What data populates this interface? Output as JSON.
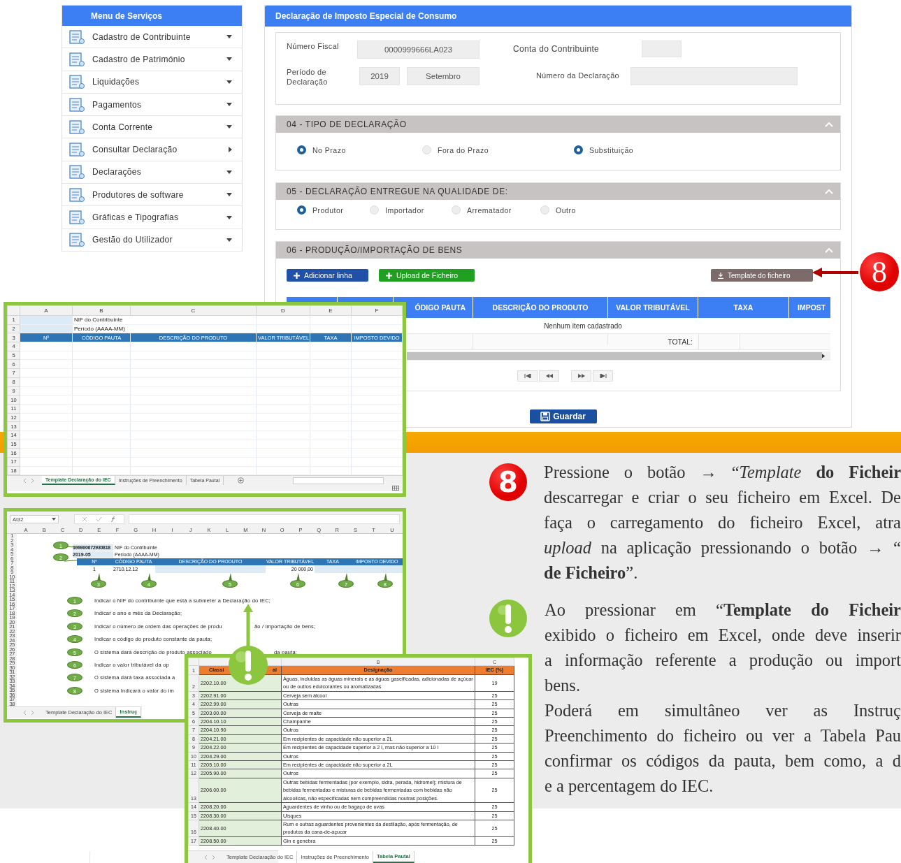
{
  "menu": {
    "title": "Menu de Serviços",
    "items": [
      {
        "label": "Cadastro de Contribuinte",
        "kind": "down"
      },
      {
        "label": "Cadastro de Património",
        "kind": "down"
      },
      {
        "label": "Liquidações",
        "kind": "down"
      },
      {
        "label": "Pagamentos",
        "kind": "down"
      },
      {
        "label": "Conta Corrente",
        "kind": "down"
      },
      {
        "label": "Consultar Declaração",
        "kind": "right"
      },
      {
        "label": "Declarações",
        "kind": "down"
      },
      {
        "label": "Produtores de software",
        "kind": "down"
      },
      {
        "label": "Gráficas e Tipografias",
        "kind": "down"
      },
      {
        "label": "Gestão do Utilizador",
        "kind": "down"
      }
    ]
  },
  "form": {
    "title": "Declaração de Imposto Especial de Consumo",
    "numero_fiscal": {
      "label": "Número Fiscal",
      "value": "0000999666LA023"
    },
    "conta": {
      "label": "Conta do Contribuinte"
    },
    "periodo": {
      "label": "Período de Declaração",
      "year": "2019",
      "month": "Setembro"
    },
    "numero_declaracao": {
      "label": "Número da Declaração"
    },
    "sections": [
      {
        "title": "04 - TIPO DE DECLARAÇÃO",
        "options": [
          {
            "label": "No Prazo",
            "selected": true
          },
          {
            "label": "Fora do Prazo",
            "selected": false
          },
          {
            "label": "Substituição",
            "selected": true
          }
        ]
      },
      {
        "title": "05 - DECLARAÇÃO ENTREGUE NA QUALIDADE DE:",
        "options": [
          {
            "label": "Produtor",
            "selected": true
          },
          {
            "label": "Importador",
            "selected": false
          },
          {
            "label": "Arrematador",
            "selected": false
          },
          {
            "label": "Outro",
            "selected": false
          }
        ]
      },
      {
        "title": "06 - PRODUÇÃO/IMPORTAÇÃO DE BENS"
      }
    ],
    "buttons": [
      {
        "label": "Adicionar linha",
        "kind": "add"
      },
      {
        "label": "Upload de Ficheiro",
        "kind": "upload"
      },
      {
        "label": "Template do ficheiro",
        "kind": "template"
      }
    ],
    "table": {
      "columns": [
        "ÓDIGO PAUTA",
        "DESCRIÇÃO DO PRODUTO",
        "VALOR TRIBUTÁVEL",
        "TAXA",
        "IMPOST"
      ],
      "empty": "Nenhum item cadastrado",
      "total_label": "TOTAL:"
    },
    "save_button": "Guardar"
  },
  "callout": {
    "number": "8"
  },
  "template_sheet": {
    "columns": [
      "A",
      "B",
      "C",
      "D",
      "E",
      "F"
    ],
    "rows": [
      "1",
      "2",
      "3",
      "4",
      "5",
      "6",
      "7",
      "8",
      "9",
      "10",
      "11",
      "12",
      "13",
      "14",
      "15",
      "16",
      "17",
      "18"
    ],
    "labels": [
      "NIF do Contribuinte",
      "Período (AAAA-MM)"
    ],
    "header": [
      "Nº",
      "CÓDIGO PAUTA",
      "DESCRIÇÃO DO PRODUTO",
      "VALOR TRIBUTÁVEL",
      "TAXA",
      "IMPOSTO DEVIDO"
    ],
    "tabs": [
      {
        "label": "Template Declaração do IEC",
        "selected": true
      },
      {
        "label": "Instruções de Preenchimento",
        "selected": false
      },
      {
        "label": "Tabela Pautal",
        "selected": false
      }
    ]
  },
  "instructions_sheet": {
    "name_box": "AI32",
    "columns": [
      "A",
      "B",
      "C",
      "D",
      "E",
      "F",
      "G",
      "H",
      "I",
      "J",
      "K",
      "L",
      "M",
      "N",
      "O",
      "P",
      "Q",
      "R",
      "S",
      "T",
      "U"
    ],
    "rows": [
      "1",
      "2",
      "3",
      "4",
      "5",
      "6",
      "7",
      "8",
      "9",
      "10",
      "11",
      "12",
      "13",
      "14",
      "15",
      "16",
      "17",
      "18",
      "19",
      "20",
      "21",
      "22",
      "23",
      "24",
      "25",
      "26",
      "27",
      "28",
      "29",
      "30",
      "31",
      "32",
      "33",
      "34",
      "35",
      "36",
      "37",
      "38"
    ],
    "nif_value": "100000672930818",
    "nif_label": "NIF do Contribuinte",
    "period_value": "2019-05",
    "period_label": "Período (AAAA-MM)",
    "header": [
      "Nº",
      "CÓDIGO PAUTA",
      "DESCRIÇÃO DO PRODUTO",
      "VALOR TRIBUTÁVEL",
      "TAXA",
      "IMPOSTO DEVIDO"
    ],
    "row": {
      "number": "1",
      "code": "2710.12.12",
      "value": "20 000,00"
    },
    "top_callouts": [
      "1",
      "2"
    ],
    "column_callouts": [
      "3",
      "4",
      "5",
      "6",
      "7",
      "8"
    ],
    "instructions": [
      {
        "number": "1",
        "text": "Indicar o NIF do contribuinte que está a submeter a Declaração do IEC;"
      },
      {
        "number": "2",
        "text": "Indicar o ano e mês da Declaração;"
      },
      {
        "number": "3",
        "text": "Indicar o número de ordem das operações de produ",
        "tail": "ão / importação de bens;"
      },
      {
        "number": "4",
        "text": "Indicar o código do produto constante da pauta;"
      },
      {
        "number": "5",
        "text": "O sistema dará descrição do produto associado",
        "tail": "da pauta;"
      },
      {
        "number": "6",
        "text": "Indicar o valor tributável da op"
      },
      {
        "number": "7",
        "text": "O sistema dará taxa associada a"
      },
      {
        "number": "8",
        "text": "O sistema Indicará o valor do im"
      }
    ],
    "tabs": [
      {
        "label": "Template Declaração do IEC",
        "selected": false
      },
      {
        "label": "Instruç",
        "selected": true
      }
    ]
  },
  "tariff_sheet": {
    "columns": [
      "B",
      "C"
    ],
    "header": {
      "code_parts": [
        "Classi",
        "al"
      ],
      "designation": "Designação",
      "rate": "IEC (%)"
    },
    "rows": [
      {
        "n": "2",
        "code": "2202.10.00",
        "designation": "Águas, incluidas as águas minerais e as águas gaseificadas, adicionadas de açúcar ou de outros edulcorantes ou aromatizadas",
        "rate": "19"
      },
      {
        "n": "3",
        "code": "2202.91.00",
        "designation": "Cerveja sem álcool",
        "rate": "25"
      },
      {
        "n": "4",
        "code": "2202.99.00",
        "designation": "Outras",
        "rate": "25"
      },
      {
        "n": "5",
        "code": "2203.00.00",
        "designation": "Cerveja de malte",
        "rate": "25"
      },
      {
        "n": "6",
        "code": "2204.10.10",
        "designation": "Champanhe",
        "rate": "25"
      },
      {
        "n": "7",
        "code": "2204.10.90",
        "designation": "Outros",
        "rate": "25"
      },
      {
        "n": "8",
        "code": "2204.21.00",
        "designation": "Em recipientes de capacidade não superior a 2L",
        "rate": "25"
      },
      {
        "n": "9",
        "code": "2204.22.00",
        "designation": "Em recipientes de capacidade superior a 2 l, mas não superior a 10 l",
        "rate": "25"
      },
      {
        "n": "10",
        "code": "2204.29.00",
        "designation": "Outros",
        "rate": "25"
      },
      {
        "n": "11",
        "code": "2205.10.00",
        "designation": "Em recipientes de capacidade não superior a 2L",
        "rate": "25"
      },
      {
        "n": "12",
        "code": "2205.90.00",
        "designation": "Outros",
        "rate": "25"
      },
      {
        "n": "13",
        "code": "2206.00.00",
        "designation": "Outras bebidas fermentadas (por exemplo, sidra, perada, hidromel); mistura de bebidas fermentadas e misturas de bebidas fermentadas com bebidas não álcoolicas, não especificadas nem compreendidas noutras posições.",
        "rate": "25"
      },
      {
        "n": "14",
        "code": "2208.20.00",
        "designation": "Aguardentes de vinho ou de bagaço de uvas",
        "rate": "25"
      },
      {
        "n": "15",
        "code": "2208.30.00",
        "designation": "Uisques",
        "rate": "25"
      },
      {
        "n": "16",
        "code": "2208.40.00",
        "designation": "Rum e outras aguardentes provenientes da destilação, após fermentação, de produtos da cana-de-açucar",
        "rate": "25"
      },
      {
        "n": "17",
        "code": "2208.50.00",
        "designation": "Gin e genebra",
        "rate": "25"
      }
    ],
    "row_header": "1",
    "tabs": [
      {
        "label": "Template Declaração do IEC",
        "selected": false
      },
      {
        "label": "Instruções de Preenchimento",
        "selected": false
      },
      {
        "label": "Tabela Pautal",
        "selected": true
      }
    ]
  },
  "notes": [
    {
      "kind": "step",
      "badge": "8",
      "lines": [
        {
          "text": "Pressione o botão → “*Template* **do Ficheir**",
          "kind": "full"
        },
        {
          "text": "descarregar e criar o seu ficheiro em Excel. De",
          "kind": "full"
        },
        {
          "text": "faça o carregamento do ficheiro Excel, atra",
          "kind": "full"
        },
        {
          "text": "*upload* na aplicação pressionando o botão → “",
          "kind": "full"
        },
        {
          "text": "**de Ficheiro**”.",
          "kind": "last"
        }
      ]
    },
    {
      "kind": "warning",
      "lines": [
        {
          "text": "Ao pressionar em “**Template do Ficheir**",
          "kind": "full"
        },
        {
          "text": "exibido o ficheiro em Excel, onde deve inserir",
          "kind": "full"
        },
        {
          "text": "a informação referente a produção ou import",
          "kind": "full"
        },
        {
          "text": "bens.",
          "kind": "last"
        },
        {
          "text": "Poderá em simultâneo ver as Instruç",
          "kind": "full"
        },
        {
          "text": "Preenchimento do ficheiro ou ver a Tabela Pau",
          "kind": "full"
        },
        {
          "text": "confirmar os códigos da pauta, bem como, a d",
          "kind": "full"
        },
        {
          "text": "e a percentagem do IEC.",
          "kind": "last"
        }
      ]
    }
  ]
}
